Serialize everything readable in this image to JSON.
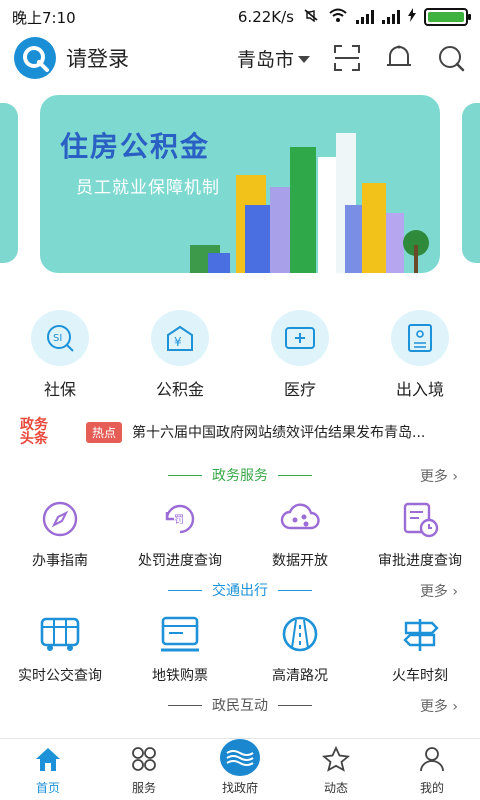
{
  "status_bar": {
    "time": "晚上7:10",
    "speed": "6.22K/s",
    "battery_color": "#3fb13f"
  },
  "header": {
    "login": "请登录",
    "city": "青岛市",
    "icons": [
      "scan-icon",
      "bell-icon",
      "search-icon"
    ]
  },
  "banner": {
    "title": "住房公积金",
    "subtitle": "员工就业保障机制",
    "background": "#7edad1"
  },
  "quick": [
    {
      "label": "社保",
      "icon": "social-security-icon"
    },
    {
      "label": "公积金",
      "icon": "provident-fund-icon"
    },
    {
      "label": "医疗",
      "icon": "medical-icon"
    },
    {
      "label": "出入境",
      "icon": "passport-icon"
    }
  ],
  "news": {
    "logo_line1": "政务",
    "logo_line2": "头条",
    "badge": "热点",
    "headline": "第十六届中国政府网站绩效评估结果发布青岛..."
  },
  "sections": [
    {
      "title": "政务服务",
      "color": "#3aa84a",
      "more": "更多",
      "items": [
        {
          "label": "办事指南",
          "icon": "compass-icon"
        },
        {
          "label": "处罚进度查询",
          "icon": "penalty-icon"
        },
        {
          "label": "数据开放",
          "icon": "cloud-data-icon"
        },
        {
          "label": "审批进度查询",
          "icon": "approval-clock-icon"
        }
      ]
    },
    {
      "title": "交通出行",
      "color": "#1d92d8",
      "more": "更多",
      "items": [
        {
          "label": "实时公交查询",
          "icon": "bus-icon"
        },
        {
          "label": "地铁购票",
          "icon": "subway-icon"
        },
        {
          "label": "高清路况",
          "icon": "road-icon"
        },
        {
          "label": "火车时刻",
          "icon": "signpost-icon"
        }
      ]
    },
    {
      "title": "政民互动",
      "color": "#555555",
      "more": "更多",
      "items": []
    }
  ],
  "tabbar": [
    {
      "label": "首页",
      "icon": "home-icon",
      "active": true
    },
    {
      "label": "服务",
      "icon": "grid-icon",
      "active": false
    },
    {
      "label": "找政府",
      "icon": "government-icon",
      "active": false
    },
    {
      "label": "动态",
      "icon": "star-icon",
      "active": false
    },
    {
      "label": "我的",
      "icon": "user-icon",
      "active": false
    }
  ],
  "colors": {
    "accent": "#1d92d8",
    "service_purple": "#9b6bd6",
    "traffic_blue": "#1d92d8"
  }
}
